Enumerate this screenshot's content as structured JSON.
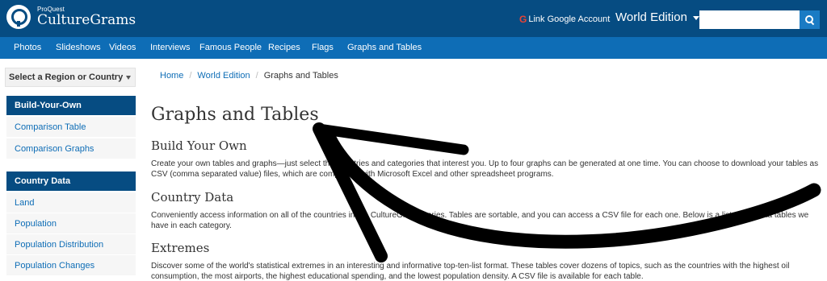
{
  "header": {
    "logo_sub": "ProQuest",
    "logo_main": "CultureGrams",
    "google_link": "Link Google Account",
    "google_glyph": "G",
    "edition": "World Edition",
    "search_placeholder": "",
    "brand_color": "#064c82",
    "nav_color": "#0e6db6"
  },
  "nav": {
    "items": [
      "Photos",
      "Slideshows",
      "Videos",
      "Interviews",
      "Famous People",
      "Recipes",
      "Flags",
      "Graphs and Tables"
    ]
  },
  "sidebar": {
    "region_select": "Select a Region or Country",
    "build_header": "Build-Your-Own",
    "build_items": [
      "Comparison Table",
      "Comparison Graphs"
    ],
    "country_header": "Country Data",
    "country_items": [
      "Land",
      "Population",
      "Population Distribution",
      "Population Changes"
    ]
  },
  "breadcrumb": {
    "home": "Home",
    "edition": "World Edition",
    "current": "Graphs and Tables",
    "separator": "/"
  },
  "main": {
    "title": "Graphs and Tables",
    "sections": [
      {
        "heading": "Build Your Own",
        "body": "Create your own tables and graphs—just select the countries and categories that interest you. Up to four graphs can be generated at one time. You can choose to download your tables as CSV (comma separated value) files, which are compatible with Microsoft Excel and other spreadsheet programs."
      },
      {
        "heading": "Country Data",
        "body": "Conveniently access information on all of the countries in the CultureGrams series. Tables are sortable, and you can access a CSV file for each one. Below is a list of the data tables we have in each category."
      },
      {
        "heading": "Extremes",
        "body": "Discover some of the world's statistical extremes in an interesting and informative top-ten-list format. These tables cover dozens of topics, such as the countries with the highest oil consumption, the most airports, the highest educational spending, and the lowest population density. A CSV file is available for each table."
      }
    ]
  }
}
